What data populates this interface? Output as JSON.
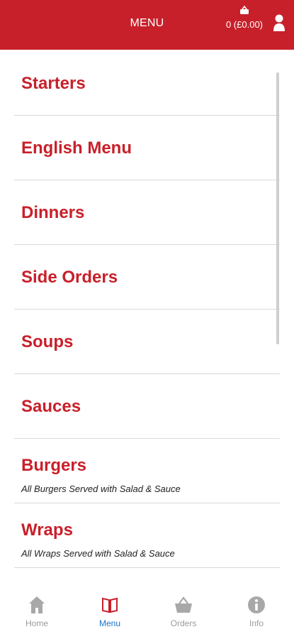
{
  "header": {
    "title": "MENU",
    "basket_count": "0 (£0.00)"
  },
  "menu_items": [
    {
      "name": "Starters",
      "subtitle": ""
    },
    {
      "name": "English Menu",
      "subtitle": ""
    },
    {
      "name": "Dinners",
      "subtitle": ""
    },
    {
      "name": "Side Orders",
      "subtitle": ""
    },
    {
      "name": "Soups",
      "subtitle": ""
    },
    {
      "name": "Sauces",
      "subtitle": ""
    },
    {
      "name": "Burgers",
      "subtitle": "All Burgers Served with Salad & Sauce"
    },
    {
      "name": "Wraps",
      "subtitle": "All Wraps Served with Salad & Sauce"
    }
  ],
  "tabs": [
    {
      "label": "Home",
      "icon": "home-icon"
    },
    {
      "label": "Menu",
      "icon": "book-icon",
      "active": true
    },
    {
      "label": "Orders",
      "icon": "basket-icon"
    },
    {
      "label": "Info",
      "icon": "info-icon"
    }
  ],
  "colors": {
    "brand_red": "#c8202a",
    "active_tab": "#1a73c8",
    "inactive_tab": "#9a9a9a"
  }
}
